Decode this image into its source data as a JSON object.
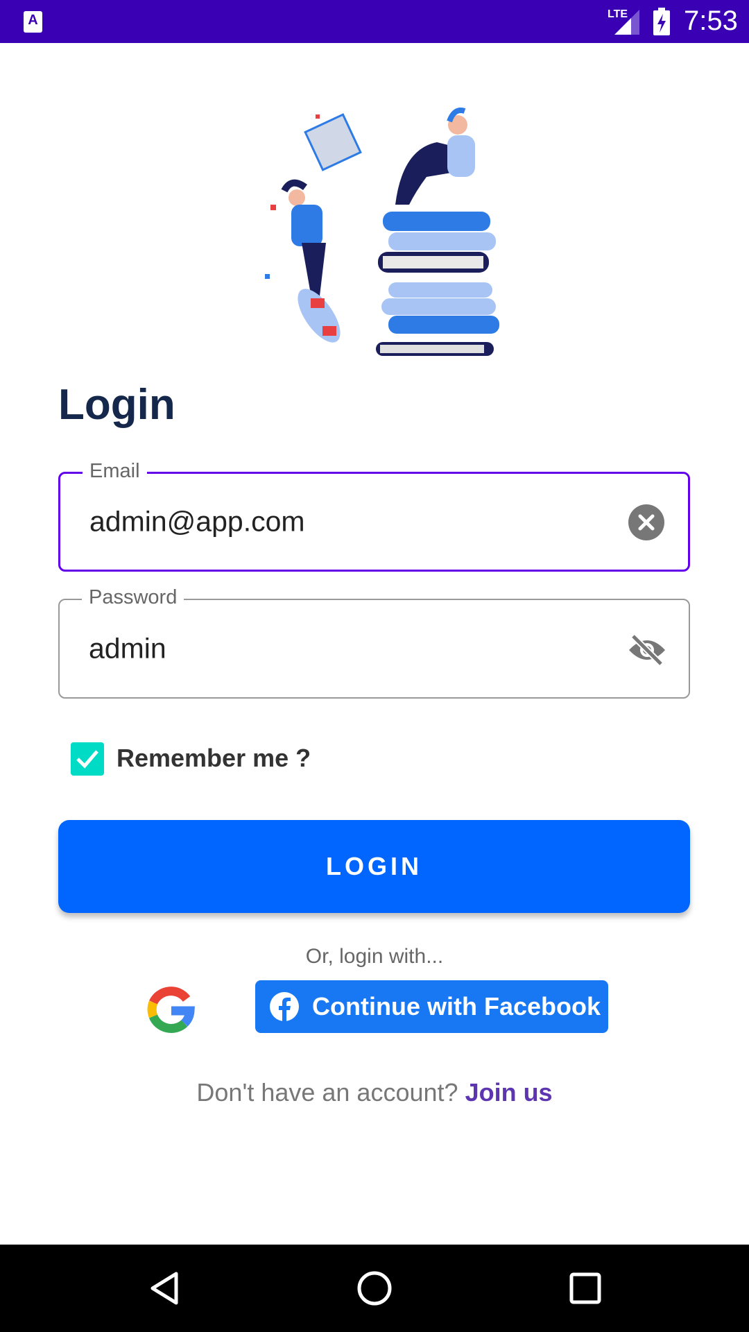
{
  "status_bar": {
    "time": "7:53",
    "network": "LTE",
    "notification_icon": "accessibility-A-icon"
  },
  "title": "Login",
  "email": {
    "label": "Email",
    "value": "admin@app.com",
    "focus_color": "#6200ea"
  },
  "password": {
    "label": "Password",
    "value": "admin"
  },
  "remember": {
    "label": "Remember me ?",
    "checked": true,
    "color": "#00dbc5"
  },
  "login_button": "LOGIN",
  "or_text": "Or, login with...",
  "facebook_button": "Continue with Facebook",
  "signup": {
    "prompt": "Don't have an account?",
    "link": "Join us"
  },
  "colors": {
    "status_bar": "#3a00b3",
    "primary": "#0066ff",
    "facebook": "#1877f2",
    "link": "#5e35b1",
    "title": "#15284b"
  }
}
